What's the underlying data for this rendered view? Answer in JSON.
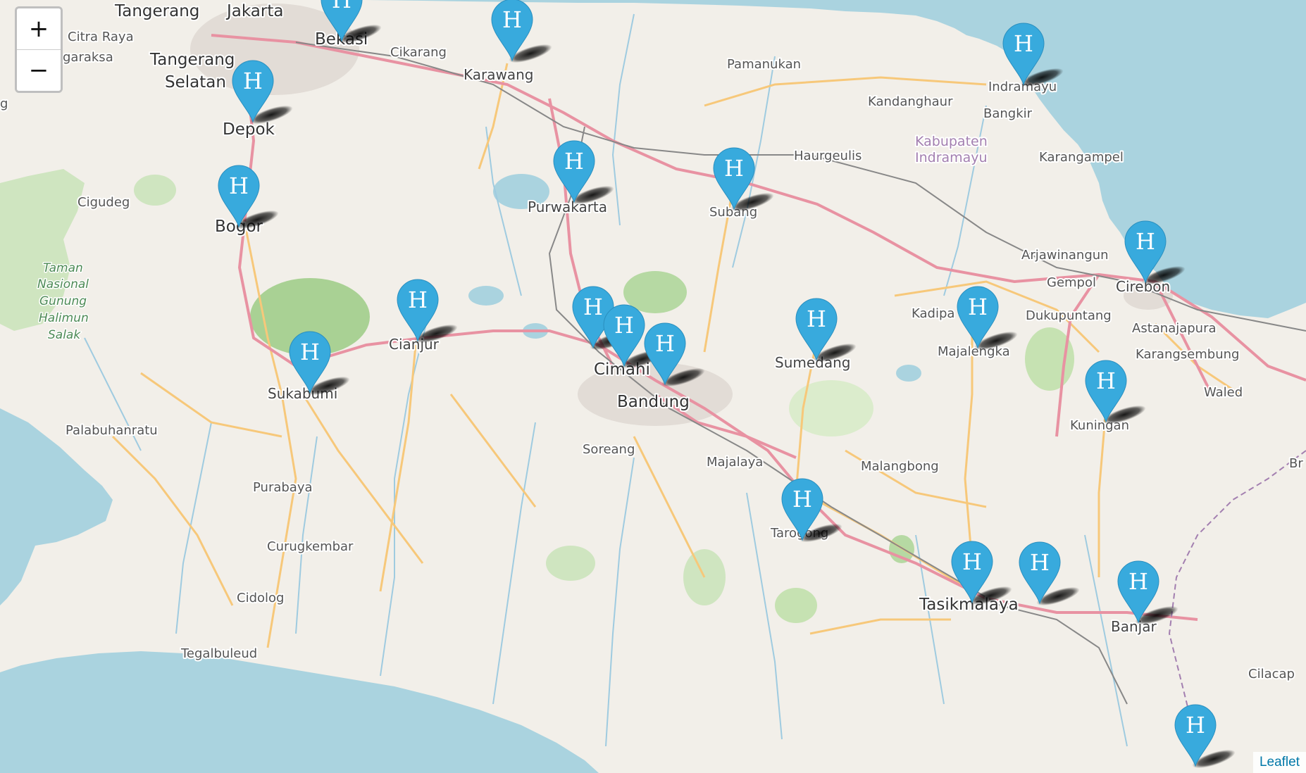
{
  "map": {
    "zoom_in_label": "+",
    "zoom_out_label": "−",
    "attribution": "Leaflet",
    "marker_glyph": "H",
    "colors": {
      "water": "#aad3df",
      "land": "#f2efe9",
      "marker": "#38aadd",
      "primary_road": "#e892a2",
      "secondary_road": "#f7c87a"
    },
    "places": {
      "tangerang": "Tangerang",
      "jakarta": "Jakarta",
      "bekasi": "Bekasi",
      "citra_raya": "Citra Raya",
      "garaksa": "garaksa",
      "tangerang_selatan_1": "Tangerang",
      "tangerang_selatan_2": "Selatan",
      "cikarang": "Cikarang",
      "karawang": "Karawang",
      "pamanukan": "Pamanukan",
      "indramayu": "Indramayu",
      "kandanghaur": "Kandanghaur",
      "bangkir": "Bangkir",
      "depok": "Depok",
      "kabupaten_1": "Kabupaten",
      "kabupaten_2": "Indramayu",
      "haurgeulis": "Haurgeulis",
      "karangampel": "Karangampel",
      "cigudeg": "Cigudeg",
      "purwakarta": "Purwakarta",
      "subang": "Subang",
      "bogor": "Bogor",
      "arjawinangun": "Arjawinangun",
      "gempol": "Gempol",
      "cirebon": "Cirebon",
      "taman_1": "Taman",
      "taman_2": "Nasional",
      "taman_3": "Gunung",
      "taman_4": "Halimun",
      "taman_5": "Salak",
      "kadipaten": "Kadipa",
      "dukupuntang": "Dukupuntang",
      "astanajapura": "Astanajapura",
      "cianjur": "Cianjur",
      "cimahi": "Cimahi",
      "sumedang": "Sumedang",
      "majalengka": "Majalengka",
      "karangsembung": "Karangsembung",
      "waled": "Waled",
      "sukabumi": "Sukabumi",
      "bandung": "Bandung",
      "kuningan": "Kuningan",
      "palabuhanratu": "Palabuhanratu",
      "soreang": "Soreang",
      "majalaya": "Majalaya",
      "malangbong": "Malangbong",
      "purabaya": "Purabaya",
      "tarogong": "Tarogong",
      "curugkembar": "Curugkembar",
      "tasikmalaya": "Tasikmalaya",
      "banjar": "Banjar",
      "cidolog": "Cidolog",
      "cilacap": "Cilacap",
      "tegalbuleud": "Tegalbuleud",
      "br": "Br",
      "g": "g"
    }
  }
}
